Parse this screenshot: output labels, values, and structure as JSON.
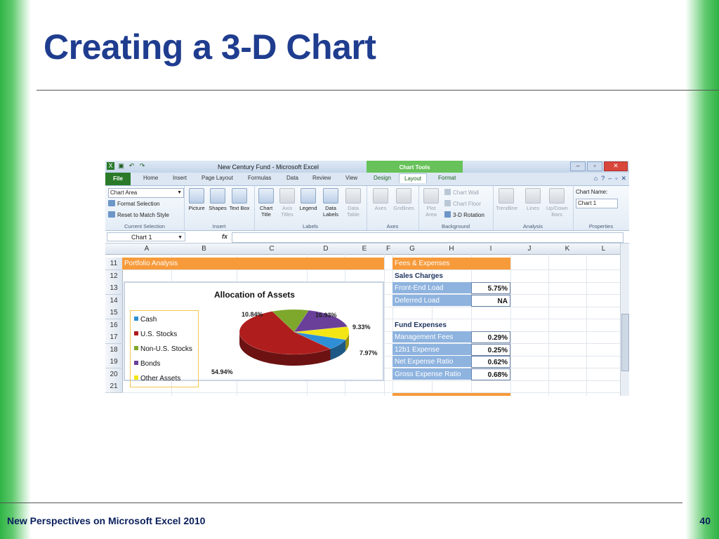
{
  "slide": {
    "title": "Creating a 3-D Chart",
    "footer_left": "New Perspectives on Microsoft Excel 2010",
    "page_number": "40"
  },
  "window": {
    "title": "New Century Fund - Microsoft Excel",
    "chart_tools": "Chart Tools"
  },
  "tabs": [
    "File",
    "Home",
    "Insert",
    "Page Layout",
    "Formulas",
    "Data",
    "Review",
    "View",
    "Design",
    "Layout",
    "Format"
  ],
  "ribbon": {
    "current_selection": {
      "dropdown": "Chart Area",
      "format_selection": "Format Selection",
      "reset": "Reset to Match Style",
      "label": "Current Selection"
    },
    "insert": {
      "picture": "Picture",
      "shapes": "Shapes",
      "text_box": "Text Box",
      "label": "Insert"
    },
    "labels": {
      "chart_title": "Chart Title",
      "axis_titles": "Axis Titles",
      "legend": "Legend",
      "data_labels": "Data Labels",
      "data_table": "Data Table",
      "label": "Labels"
    },
    "axes": {
      "axes": "Axes",
      "gridlines": "Gridlines",
      "label": "Axes"
    },
    "background": {
      "plot_area": "Plot Area",
      "chart_wall": "Chart Wall",
      "chart_floor": "Chart Floor",
      "rotation": "3-D Rotation",
      "label": "Background"
    },
    "analysis": {
      "trendline": "Trendline",
      "lines": "Lines",
      "updown": "Up/Down Bars",
      "label": "Analysis"
    },
    "properties": {
      "chart_name_label": "Chart Name:",
      "chart_name": "Chart 1",
      "label": "Properties"
    }
  },
  "formula_bar": {
    "name_box": "Chart 1",
    "fx": "fx"
  },
  "columns": [
    "A",
    "B",
    "C",
    "D",
    "E",
    "F",
    "G",
    "H",
    "I",
    "J",
    "K",
    "L"
  ],
  "rows": [
    "11",
    "12",
    "13",
    "14",
    "15",
    "16",
    "17",
    "18",
    "19",
    "20",
    "21"
  ],
  "cells": {
    "portfolio": "Portfolio Analysis",
    "fees": "Fees & Expenses",
    "sales_charges": "Sales Charges",
    "front_end": {
      "label": "Front-End Load",
      "value": "5.75%"
    },
    "deferred": {
      "label": "Deferred Load",
      "value": "NA"
    },
    "fund_expenses": "Fund Expenses",
    "management": {
      "label": "Management Fees",
      "value": "0.29%"
    },
    "b1": {
      "label": "12b1 Expense",
      "value": "0.25%"
    },
    "net": {
      "label": "Net Expense Ratio",
      "value": "0.62%"
    },
    "gross": {
      "label": "Gross Expense Ratio",
      "value": "0.68%"
    }
  },
  "chart_data": {
    "type": "pie",
    "title": "Allocation of Assets",
    "categories": [
      "Cash",
      "U.S. Stocks",
      "Non-U.S. Stocks",
      "Bonds",
      "Other Assets"
    ],
    "values": [
      7.97,
      54.94,
      10.84,
      16.93,
      9.33
    ],
    "data_labels": [
      "7.97%",
      "54.94%",
      "10.84%",
      "16.93%",
      "9.33%"
    ],
    "colors": [
      "#2f8fd6",
      "#b01d1d",
      "#7ea82c",
      "#6a3f9a",
      "#f3e614"
    ],
    "legend_position": "left"
  }
}
